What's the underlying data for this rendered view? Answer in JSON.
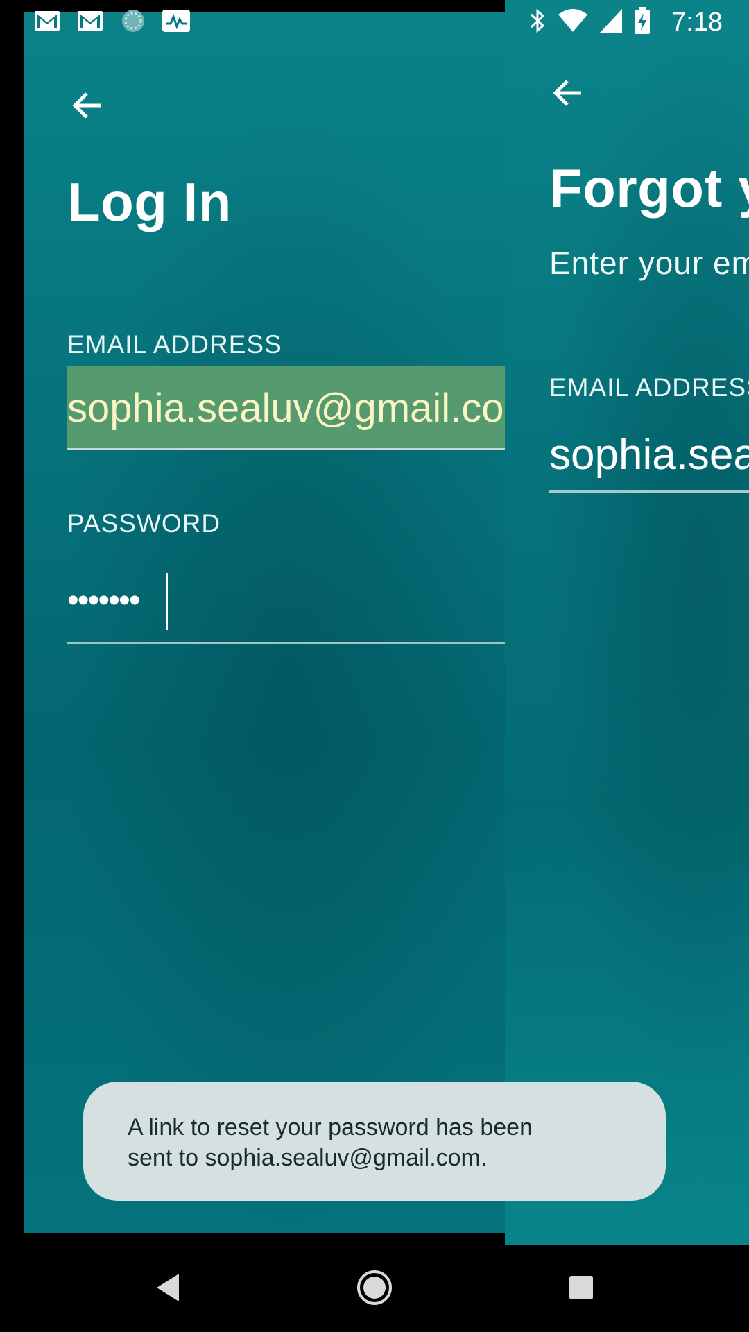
{
  "status_bar": {
    "time": "7:18",
    "left_icons": [
      "gmail-icon",
      "gmail-icon",
      "sync-icon",
      "activity-icon"
    ],
    "right_icons": [
      "bluetooth-icon",
      "wifi-icon",
      "signal-icon",
      "battery-charging-icon"
    ]
  },
  "login_screen": {
    "title": "Log In",
    "email_label": "EMAIL ADDRESS",
    "email_value": "sophia.sealuv@gmail.com",
    "password_label": "PASSWORD",
    "password_value": "•••••••"
  },
  "forgot_screen": {
    "title": "Forgot your password?",
    "subtitle": "Enter your email address",
    "email_label": "EMAIL ADDRESS",
    "email_value": "sophia.sealuv@gmail.com"
  },
  "toast": {
    "line1": "A link to reset your password has been",
    "line2": "sent to sophia.sealuv@gmail.com."
  },
  "colors": {
    "teal": "#06727b",
    "autofill_bg": "#559b6f",
    "autofill_text": "#fbf5c4",
    "toast_bg": "#d5e1e1"
  }
}
